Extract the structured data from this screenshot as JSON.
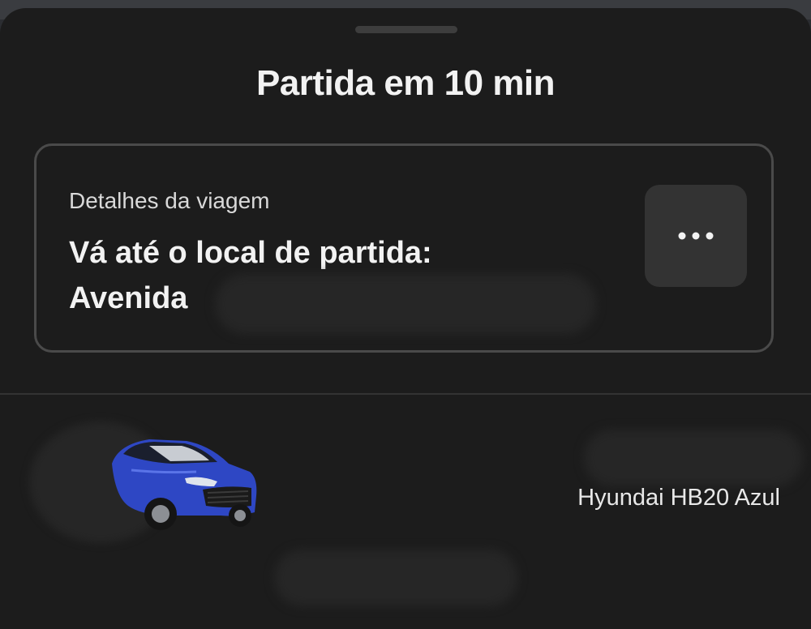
{
  "sheet": {
    "title": "Partida em 10 min"
  },
  "trip_card": {
    "label": "Detalhes da viagem",
    "instruction": "Vá até o local de partida:",
    "address_visible": "Avenida",
    "more_icon": "more-horizontal-icon"
  },
  "vehicle": {
    "model": "Hyundai HB20 Azul",
    "image": "car-image",
    "color": "#2e47c4"
  },
  "colors": {
    "background": "#1c1c1c",
    "card_border": "#4a4a4a",
    "button": "#333333",
    "text": "#f2f2f2"
  }
}
